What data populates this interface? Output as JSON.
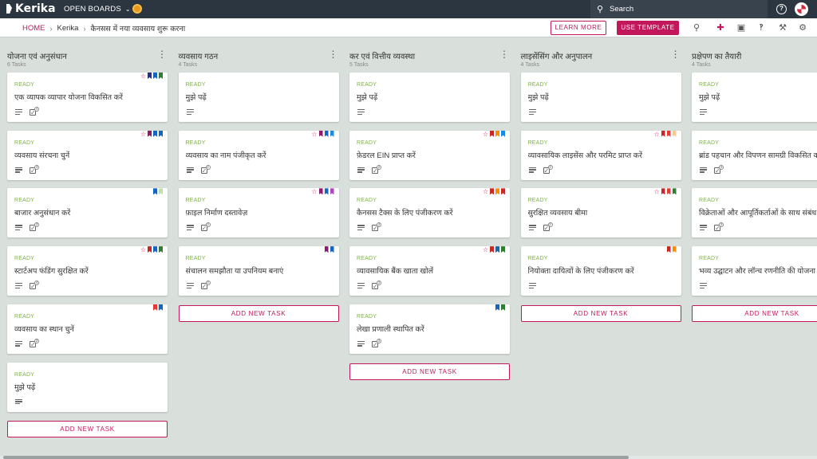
{
  "topbar": {
    "logo": "Kerika",
    "open_boards": "OPEN BOARDS",
    "search_placeholder": "Search",
    "icons": [
      "sun-icon",
      "search-icon",
      "help-icon",
      "user-avatar"
    ]
  },
  "subbar": {
    "breadcrumb": [
      "HOME",
      "Kerika",
      "कैनसस में नया व्यवसाय शुरू करना"
    ],
    "learn_more": "LEARN MORE",
    "use_template": "USE TEMPLATE",
    "tool_icons": [
      "search-icon",
      "add-user-icon",
      "chat-icon",
      "attachment-icon",
      "wrench-icon",
      "gear-icon"
    ]
  },
  "colors": {
    "accent": "#c2185b",
    "topbar": "#2c3640",
    "board_bg": "#d9dfdb",
    "status_ready": "#7cb342"
  },
  "add_task_label": "ADD NEW TASK",
  "columns": [
    {
      "title": "योजना एवं अनुसंधान",
      "count": "6 Tasks",
      "cards": [
        {
          "status": "READY",
          "title": "एक व्यापक व्यापार योजना विकसित करें",
          "star": true,
          "flags": [
            "#2c2c8c",
            "#1565c0",
            "#2e7d32"
          ],
          "checklist": "4",
          "desc": true
        },
        {
          "status": "READY",
          "title": "व्यवसाय संरचना चुनें",
          "star": true,
          "flags": [
            "#8e1a6e",
            "#1565c0",
            "#1565c0"
          ],
          "checklist": "4",
          "desc": true
        },
        {
          "status": "READY",
          "title": "बाजार अनुसंधान करें",
          "star": false,
          "flags": [
            "#1565c0",
            "#c5e1a5"
          ],
          "checklist": "3",
          "desc": true
        },
        {
          "status": "READY",
          "title": "स्टार्टअप फंडिंग सुरक्षित करें",
          "star": true,
          "flags": [
            "#c62828",
            "#1565c0",
            "#2e7d32"
          ],
          "checklist": "4",
          "desc": true
        },
        {
          "status": "READY",
          "title": "व्यवसाय का स्थान चुनें",
          "star": false,
          "flags": [
            "#e53935",
            "#1565c0"
          ],
          "checklist": "3",
          "desc": true
        },
        {
          "status": "READY",
          "title": "मुझे पढ़ें",
          "star": false,
          "flags": [],
          "checklist": "",
          "desc": true
        }
      ]
    },
    {
      "title": "व्यवसाय गठन",
      "count": "4 Tasks",
      "cards": [
        {
          "status": "READY",
          "title": "मुझे पढ़ें",
          "star": false,
          "flags": [],
          "checklist": "",
          "desc": true
        },
        {
          "status": "READY",
          "title": "व्यवसाय का नाम पंजीकृत करें",
          "star": true,
          "flags": [
            "#8e1a6e",
            "#1565c0",
            "#1e88e5"
          ],
          "checklist": "2",
          "desc": true
        },
        {
          "status": "READY",
          "title": "फ़ाइल निर्माण दस्तावेज़",
          "star": true,
          "flags": [
            "#8e1a6e",
            "#1565c0",
            "#ab47bc"
          ],
          "checklist": "3",
          "desc": true
        },
        {
          "status": "READY",
          "title": "संचालन समझौता या उपनियम बनाएं",
          "star": false,
          "flags": [
            "#8e1a6e",
            "#1565c0"
          ],
          "checklist": "3",
          "desc": true
        }
      ]
    },
    {
      "title": "कर एवं वित्तीय व्यवस्था",
      "count": "5 Tasks",
      "cards": [
        {
          "status": "READY",
          "title": "मुझे पढ़ें",
          "star": false,
          "flags": [],
          "checklist": "",
          "desc": true
        },
        {
          "status": "READY",
          "title": "फ़ेडरल EIN प्राप्त करें",
          "star": true,
          "flags": [
            "#c62828",
            "#fb8c00",
            "#1e88e5"
          ],
          "checklist": "2",
          "desc": true
        },
        {
          "status": "READY",
          "title": "कैनसस टैक्स के लिए पंजीकरण करें",
          "star": true,
          "flags": [
            "#c62828",
            "#fb8c00",
            "#c62828"
          ],
          "checklist": "3",
          "desc": true
        },
        {
          "status": "READY",
          "title": "व्यावसायिक बैंक खाता खोलें",
          "star": true,
          "flags": [
            "#c62828",
            "#1565c0",
            "#2e7d32"
          ],
          "checklist": "3",
          "desc": true
        },
        {
          "status": "READY",
          "title": "लेखा प्रणाली स्थापित करें",
          "star": false,
          "flags": [
            "#1565c0",
            "#2e7d32"
          ],
          "checklist": "3",
          "desc": true
        }
      ]
    },
    {
      "title": "लाइसेंसिंग और अनुपालन",
      "count": "4 Tasks",
      "cards": [
        {
          "status": "READY",
          "title": "मुझे पढ़ें",
          "star": false,
          "flags": [],
          "checklist": "",
          "desc": true
        },
        {
          "status": "READY",
          "title": "व्यावसायिक लाइसेंस और परमिट प्राप्त करें",
          "star": true,
          "flags": [
            "#c62828",
            "#e53935",
            "#f5c98a"
          ],
          "checklist": "3",
          "desc": true
        },
        {
          "status": "READY",
          "title": "सुरक्षित व्यवसाय बीमा",
          "star": true,
          "flags": [
            "#c62828",
            "#e53935",
            "#2e7d32"
          ],
          "checklist": "3",
          "desc": true
        },
        {
          "status": "READY",
          "title": "नियोक्ता दायित्वों के लिए पंजीकरण करें",
          "star": false,
          "flags": [
            "#c62828",
            "#fb8c00"
          ],
          "checklist": "",
          "desc": true
        }
      ]
    },
    {
      "title": "प्रक्षेपण का तैयारी",
      "count": "4 Tasks",
      "cards": [
        {
          "status": "READY",
          "title": "मुझे पढ़ें",
          "star": false,
          "flags": [],
          "checklist": "",
          "desc": true
        },
        {
          "status": "READY",
          "title": "ब्रांड पहचान और विपणन सामग्री विकसित करें",
          "star": false,
          "flags": [],
          "checklist": "3",
          "desc": true
        },
        {
          "status": "READY",
          "title": "विक्रेताओं और आपूर्तिकर्ताओं के साथ संबंध स्थापित करें",
          "star": false,
          "flags": [],
          "checklist": "3",
          "desc": true
        },
        {
          "status": "READY",
          "title": "भव्य उद्घाटन और लॉन्च रणनीति की योजना बनाएं",
          "star": false,
          "flags": [],
          "checklist": "",
          "desc": true
        }
      ]
    }
  ]
}
